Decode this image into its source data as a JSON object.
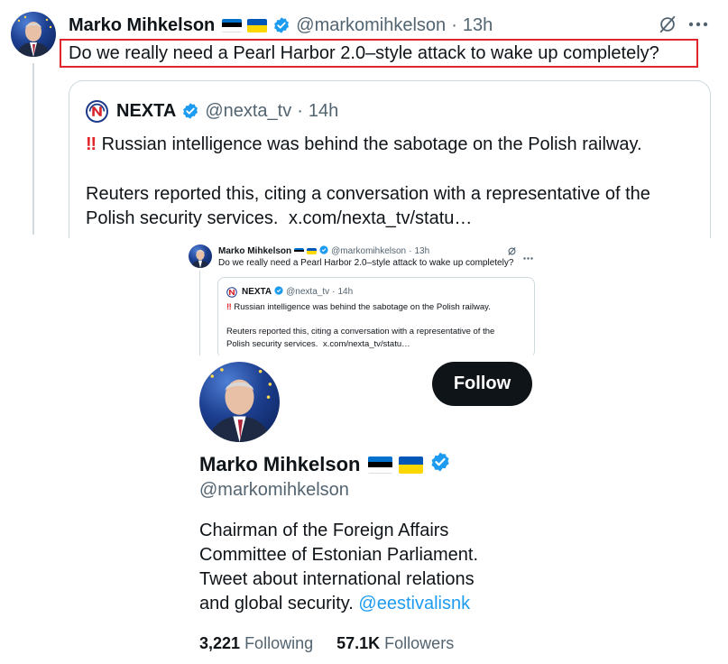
{
  "tweet": {
    "author_name": "Marko Mihkelson",
    "author_handle": "@markomihkelson",
    "separator": "·",
    "time": "13h",
    "text": "Do we really need a Pearl Harbor 2.0–style attack to wake up completely?",
    "more_icon": "more-horizontal-icon",
    "grok_icon": "grok-slash-icon",
    "highlight_color": "#e0262b"
  },
  "quoted": {
    "author_name": "NEXTA",
    "author_handle": "@nexta_tv",
    "separator": "·",
    "time": "14h",
    "alert_glyph": "‼",
    "line1": "Russian intelligence was behind the sabotage on the Polish railway.",
    "line2a": "Reuters reported this, citing a conversation with a representative of the",
    "line2b": "Polish security services.",
    "link": "x.com/nexta_tv/statu…"
  },
  "profile": {
    "name": "Marko Mihkelson",
    "handle": "@markomihkelson",
    "follow_label": "Follow",
    "bio_line1": "Chairman of the Foreign Affairs",
    "bio_line2": "Committee of Estonian Parliament.",
    "bio_line3": "Tweet about international relations",
    "bio_line4": "and global security.",
    "bio_mention": "@eestivalisnk",
    "following_count": "3,221",
    "following_label": "Following",
    "followers_count": "57.1K",
    "followers_label": "Followers"
  },
  "colors": {
    "verified_blue": "#1d9bf0",
    "text": "#0f1419",
    "muted": "#536471",
    "border": "#cfd9de",
    "ee_blue": "#0072ce",
    "ee_black": "#000000",
    "ee_white": "#ffffff",
    "ua_blue": "#0057b7",
    "ua_yellow": "#ffd700"
  }
}
